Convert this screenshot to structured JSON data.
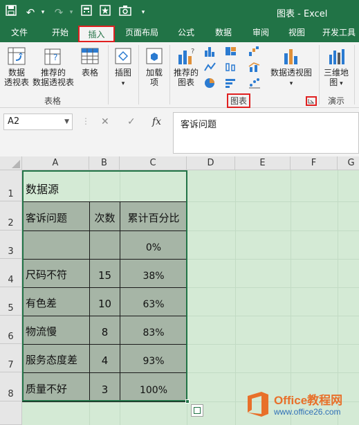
{
  "window": {
    "title": "图表 - Excel"
  },
  "quick_access": {
    "save_icon": "save-icon",
    "undo_icon": "undo-icon",
    "redo_icon": "redo-icon"
  },
  "tabs": [
    {
      "label": "文件"
    },
    {
      "label": "开始"
    },
    {
      "label": "插入",
      "active": true
    },
    {
      "label": "页面布局"
    },
    {
      "label": "公式"
    },
    {
      "label": "数据"
    },
    {
      "label": "审阅"
    },
    {
      "label": "视图"
    },
    {
      "label": "开发工具"
    }
  ],
  "ribbon": {
    "tables": {
      "pivot_line1": "数据",
      "pivot_line2": "透视表",
      "rec_pivot_line1": "推荐的",
      "rec_pivot_line2": "数据透视表",
      "table": "表格",
      "group": "表格"
    },
    "illustrations": {
      "label": "插图"
    },
    "addins": {
      "line1": "加载",
      "line2": "项"
    },
    "charts": {
      "rec_line1": "推荐的",
      "rec_line2": "图表",
      "pivot_chart": "数据透视图",
      "group": "图表"
    },
    "tours": {
      "line1": "三维地",
      "line2": "图",
      "group": "演示"
    }
  },
  "formula_bar": {
    "name_box": "A2",
    "cancel": "✕",
    "enter": "✓",
    "fx": "fx",
    "content": "客诉问题"
  },
  "columns": [
    "A",
    "B",
    "C",
    "D",
    "E",
    "F",
    "G"
  ],
  "rows": [
    "1",
    "2",
    "3",
    "4",
    "5",
    "6",
    "7",
    "8"
  ],
  "sheet": {
    "title": "数据源",
    "headers": [
      "客诉问题",
      "次数",
      "累计百分比"
    ],
    "data": [
      {
        "issue": "",
        "count": "",
        "pct": "0%"
      },
      {
        "issue": "尺码不符",
        "count": "15",
        "pct": "38%"
      },
      {
        "issue": "有色差",
        "count": "10",
        "pct": "63%"
      },
      {
        "issue": "物流慢",
        "count": "8",
        "pct": "83%"
      },
      {
        "issue": "服务态度差",
        "count": "4",
        "pct": "93%"
      },
      {
        "issue": "质量不好",
        "count": "3",
        "pct": "100%"
      }
    ]
  },
  "watermark": {
    "brand": "Office教程网",
    "url": "www.office26.com"
  },
  "colors": {
    "excel_green": "#217346",
    "highlight_red": "#e02020",
    "table_fill": "#a6b5a6",
    "sheet_bg": "#d4ead5"
  }
}
